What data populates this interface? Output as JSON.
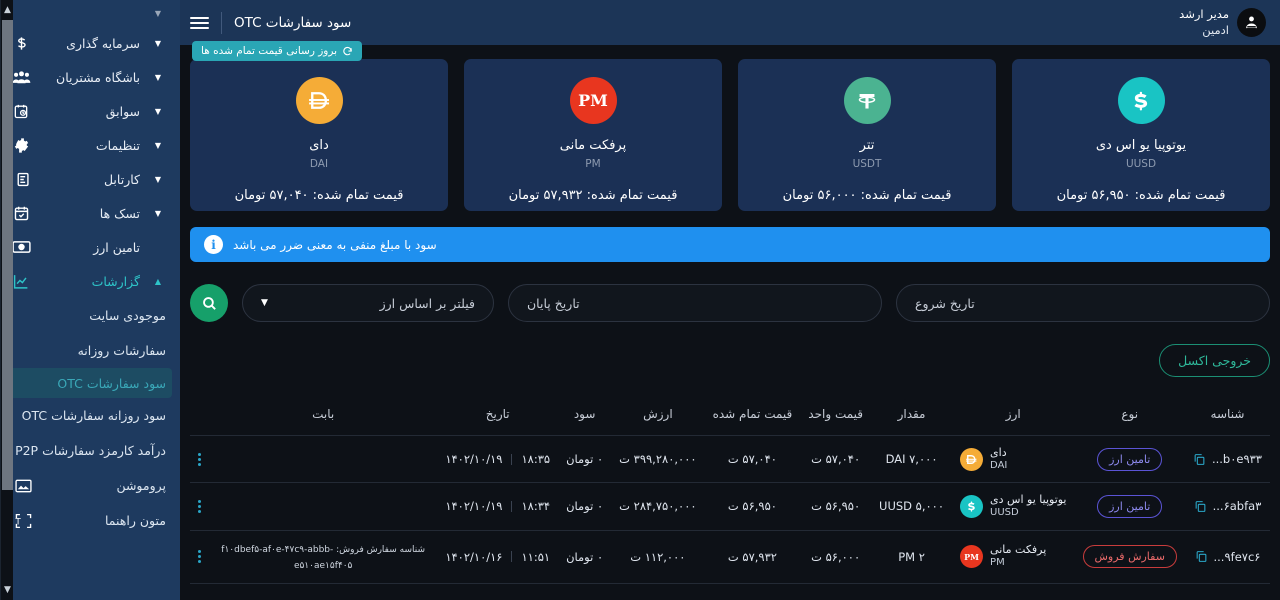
{
  "header": {
    "page_title": "سود سفارشات OTC",
    "menu_icon": "hamburger-icon",
    "user_role": "مدیر ارشد",
    "user_name": "ادمین"
  },
  "sidebar": {
    "items": [
      {
        "label": "سرمایه گذاری",
        "icon": "dollar-icon",
        "expandable": true
      },
      {
        "label": "باشگاه مشتریان",
        "icon": "users-icon",
        "expandable": true
      },
      {
        "label": "سوابق",
        "icon": "history-icon",
        "expandable": true
      },
      {
        "label": "تنظیمات",
        "icon": "gear-icon",
        "expandable": true
      },
      {
        "label": "کارتابل",
        "icon": "clipboard-question-icon",
        "expandable": true
      },
      {
        "label": "تسک ها",
        "icon": "calendar-check-icon",
        "expandable": true
      },
      {
        "label": "تامین ارز",
        "icon": "money-icon",
        "expandable": false
      },
      {
        "label": "گزارشات",
        "icon": "chart-line-icon",
        "expandable": true,
        "active": true
      }
    ],
    "sub_items": [
      {
        "label": "موجودی سایت",
        "icon": ""
      },
      {
        "label": "سفارشات روزانه",
        "icon": ""
      },
      {
        "label": "سود سفارشات OTC",
        "icon": "",
        "selected": true
      },
      {
        "label": "سود روزانه سفارشات OTC",
        "icon": ""
      },
      {
        "label": "درآمد کارمزد سفارشات P2P",
        "icon": ""
      },
      {
        "label": "پروموشن",
        "icon": "image-icon"
      },
      {
        "label": "متون راهنما",
        "icon": "text-frame-icon"
      }
    ]
  },
  "refresh_badge": {
    "label": "بروز رسانی قیمت تمام شده ها",
    "icon": "refresh-icon"
  },
  "cards": [
    {
      "name": "یوتوپیا یو اس دی",
      "symbol": "UUSD",
      "price_label": "قیمت تمام شده: ۵۶,۹۵۰ تومان",
      "color": "#19c4c4",
      "glyph": "uusd-icon"
    },
    {
      "name": "تتر",
      "symbol": "USDT",
      "price_label": "قیمت تمام شده: ۵۶,۰۰۰ تومان",
      "color": "#4bb391",
      "glyph": "usdt-icon"
    },
    {
      "name": "پرفکت مانی",
      "symbol": "PM",
      "price_label": "قیمت تمام شده: ۵۷,۹۳۲ تومان",
      "color": "#e8361f",
      "glyph": "pm-icon"
    },
    {
      "name": "دای",
      "symbol": "DAI",
      "price_label": "قیمت تمام شده: ۵۷,۰۴۰ تومان",
      "color": "#f5ac37",
      "glyph": "dai-icon"
    }
  ],
  "info_banner": {
    "text": "سود با مبلغ منفی به معنی ضرر می باشد",
    "icon": "info-icon",
    "color": "#1f90ef"
  },
  "filters": {
    "start_date_placeholder": "تاریخ شروع",
    "end_date_placeholder": "تاریخ پایان",
    "currency_filter_placeholder": "فیلتر بر اساس ارز",
    "search_icon": "search-icon",
    "caret_icon": "chevron-down-icon"
  },
  "excel_button": {
    "label": "خروجی اکسل"
  },
  "table": {
    "columns": [
      "شناسه",
      "نوع",
      "ارز",
      "مقدار",
      "قیمت واحد",
      "قیمت تمام شده",
      "ارزش",
      "سود",
      "تاریخ",
      "بابت",
      ""
    ],
    "rows": [
      {
        "id": "b۰e۹۳۳...",
        "type": {
          "label": "تامین ارز",
          "style": "supply"
        },
        "currency_name": "دای",
        "currency_symbol": "DAI",
        "currency_color": "#f5ac37",
        "currency_glyph": "dai-icon",
        "amount": "DAI ۷,۰۰۰",
        "unit_price": "۵۷,۰۴۰ ت",
        "total_price": "۵۷,۰۴۰ ت",
        "value": "۳۹۹,۲۸۰,۰۰۰ ت",
        "profit": "۰ تومان",
        "date": "۱۴۰۲/۱۰/۱۹",
        "time": "۱۸:۳۵",
        "reason": ""
      },
      {
        "id": "۶abfa۳...",
        "type": {
          "label": "تامین ارز",
          "style": "supply"
        },
        "currency_name": "یوتوپیا یو اس دی",
        "currency_symbol": "UUSD",
        "currency_color": "#19c4c4",
        "currency_glyph": "uusd-icon",
        "amount": "UUSD ۵,۰۰۰",
        "unit_price": "۵۶,۹۵۰ ت",
        "total_price": "۵۶,۹۵۰ ت",
        "value": "۲۸۴,۷۵۰,۰۰۰ ت",
        "profit": "۰ تومان",
        "date": "۱۴۰۲/۱۰/۱۹",
        "time": "۱۸:۳۴",
        "reason": ""
      },
      {
        "id": "۹fe۷c۶...",
        "type": {
          "label": "سفارش فروش",
          "style": "sell"
        },
        "currency_name": "پرفکت مانی",
        "currency_symbol": "PM",
        "currency_color": "#e8361f",
        "currency_glyph": "pm-icon",
        "amount": "PM ۲",
        "unit_price": "۵۶,۰۰۰ ت",
        "total_price": "۵۷,۹۳۲ ت",
        "value": "۱۱۲,۰۰۰ ت",
        "profit": "۰ تومان",
        "date": "۱۴۰۲/۱۰/۱۶",
        "time": "۱۱:۵۱",
        "reason": "شناسه سفارش فروش: f۱۰dbef۵-af۰e-۴۷c۹-abbb-e۵۱۰ae۱۵f۴۰۵"
      }
    ]
  }
}
